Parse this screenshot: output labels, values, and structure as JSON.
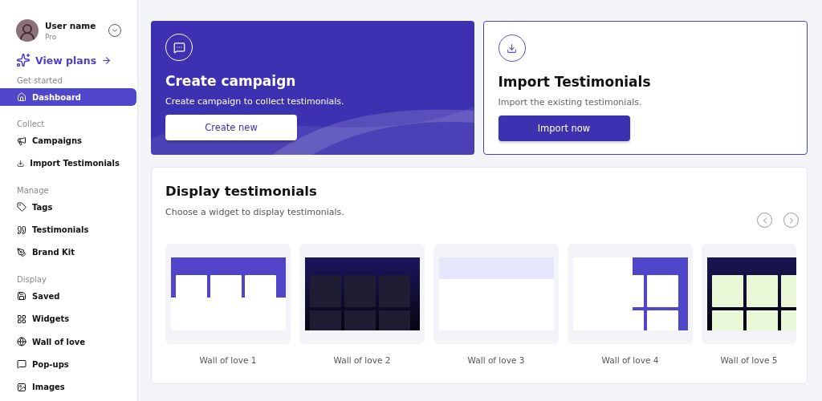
{
  "user": {
    "name": "User name",
    "plan": "Pro"
  },
  "upgrade": {
    "label": "View plans"
  },
  "sidebar": {
    "sections": [
      {
        "title": "Get started",
        "items": [
          {
            "label": "Dashboard",
            "selected": true
          }
        ]
      },
      {
        "title": "Collect",
        "items": [
          {
            "label": "Campaigns",
            "selected": false
          },
          {
            "label": "Import Testimonials",
            "selected": false
          }
        ]
      },
      {
        "title": "Manage",
        "items": [
          {
            "label": "Tags",
            "selected": false
          },
          {
            "label": "Testimonials",
            "selected": false
          },
          {
            "label": "Brand Kit",
            "selected": false
          }
        ]
      },
      {
        "title": "Display",
        "items": [
          {
            "label": "Saved",
            "selected": false
          },
          {
            "label": "Widgets",
            "selected": false
          },
          {
            "label": "Wall of love",
            "selected": false
          },
          {
            "label": "Pop-ups",
            "selected": false
          },
          {
            "label": "Images",
            "selected": false
          }
        ]
      }
    ]
  },
  "action_cards": [
    {
      "kind": "filled",
      "title": "Create campaign",
      "description": "Create campaign to collect testimonials.",
      "button": "Create new"
    },
    {
      "kind": "outlined",
      "title": "Import Testimonials",
      "description": "Import the existing testimonials.",
      "button": "Import now"
    }
  ],
  "display": {
    "title": "Display testimonials",
    "subtitle": "Choose a widget to display testimonials.",
    "widgets": [
      {
        "label": "Wall of love 1",
        "kind": "purple"
      },
      {
        "label": "Wall of love 2",
        "kind": "dark"
      },
      {
        "label": "Wall of love 3",
        "kind": "light"
      },
      {
        "label": "Wall of love 4",
        "kind": "split"
      },
      {
        "label": "Wall of love 5",
        "kind": "photo"
      }
    ]
  }
}
